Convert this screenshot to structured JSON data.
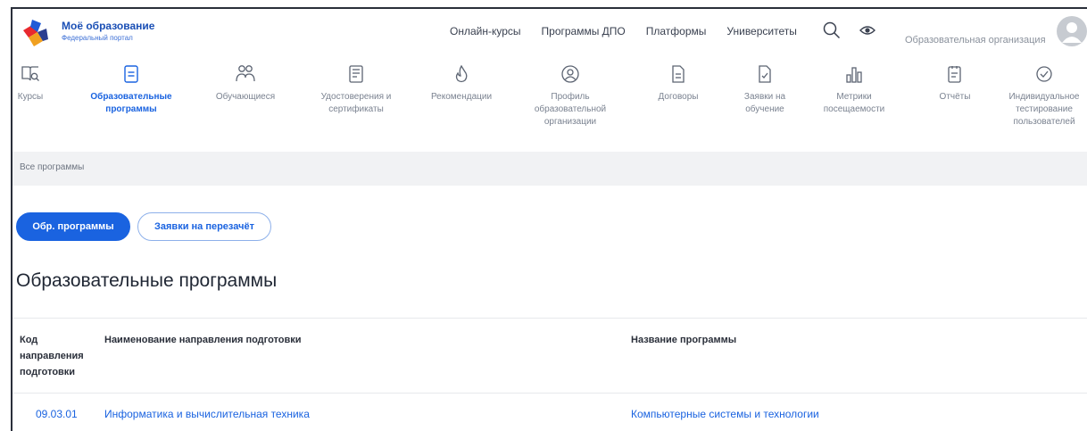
{
  "header": {
    "brand_title": "Моё образование",
    "brand_subtitle": "Федеральный портал",
    "nav": [
      "Онлайн-курсы",
      "Программы ДПО",
      "Платформы",
      "Университеты"
    ],
    "org_name": "Образовательная организация"
  },
  "iconnav": {
    "items": [
      {
        "label": "Курсы",
        "icon": "book-search-icon"
      },
      {
        "label": "Образовательные программы",
        "icon": "document-icon",
        "active": true
      },
      {
        "label": "Обучающиеся",
        "icon": "users-icon"
      },
      {
        "label": "Удостоверения и сертификаты",
        "icon": "certificate-icon"
      },
      {
        "label": "Рекомендации",
        "icon": "flame-icon"
      },
      {
        "label": "Профиль образовательной организации",
        "icon": "profile-icon"
      },
      {
        "label": "Договоры",
        "icon": "contract-icon"
      },
      {
        "label": "Заявки на обучение",
        "icon": "application-icon"
      },
      {
        "label": "Метрики посещаемости",
        "icon": "bar-chart-icon"
      },
      {
        "label": "Отчёты",
        "icon": "report-icon"
      },
      {
        "label": "Индивидуальное тестирование пользователей",
        "icon": "check-circle-icon"
      }
    ]
  },
  "breadcrumb": "Все программы",
  "tabs": {
    "primary": "Обр. программы",
    "secondary": "Заявки на перезачёт"
  },
  "page_title": "Образовательные программы",
  "table": {
    "headers": {
      "code": "Код направления подготовки",
      "name": "Наименование направления подготовки",
      "program": "Название программы"
    },
    "rows": [
      {
        "code": "09.03.01",
        "name": "Информатика и вычислительная техника",
        "program": "Компьютерные системы и технологии"
      }
    ]
  },
  "colors": {
    "accent": "#1a63e0",
    "breadcrumb_bg": "#f1f2f4"
  }
}
